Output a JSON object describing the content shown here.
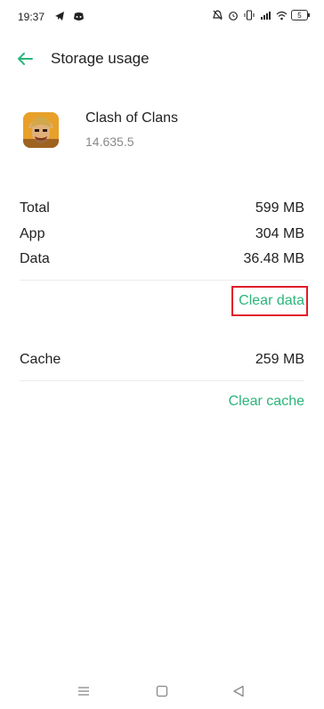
{
  "statusbar": {
    "time": "19:37",
    "left_icons": [
      "telegram-icon",
      "discord-icon"
    ],
    "right_icons": [
      "silent-icon",
      "alarm-icon",
      "vibrate-icon",
      "signal-icon",
      "wifi-icon"
    ],
    "battery": "5"
  },
  "header": {
    "title": "Storage usage",
    "back_icon": "arrow-left-icon"
  },
  "app": {
    "name": "Clash of Clans",
    "version": "14.635.5"
  },
  "storage": {
    "total_label": "Total",
    "total_value": "599 MB",
    "app_label": "App",
    "app_value": "304 MB",
    "data_label": "Data",
    "data_value": "36.48 MB",
    "clear_data": "Clear data"
  },
  "cache": {
    "label": "Cache",
    "value": "259 MB",
    "clear_cache": "Clear cache"
  },
  "colors": {
    "accent": "#2bb57a",
    "highlight": "#e11c2a"
  },
  "navbar": [
    "menu-icon",
    "home-icon",
    "back-icon"
  ]
}
